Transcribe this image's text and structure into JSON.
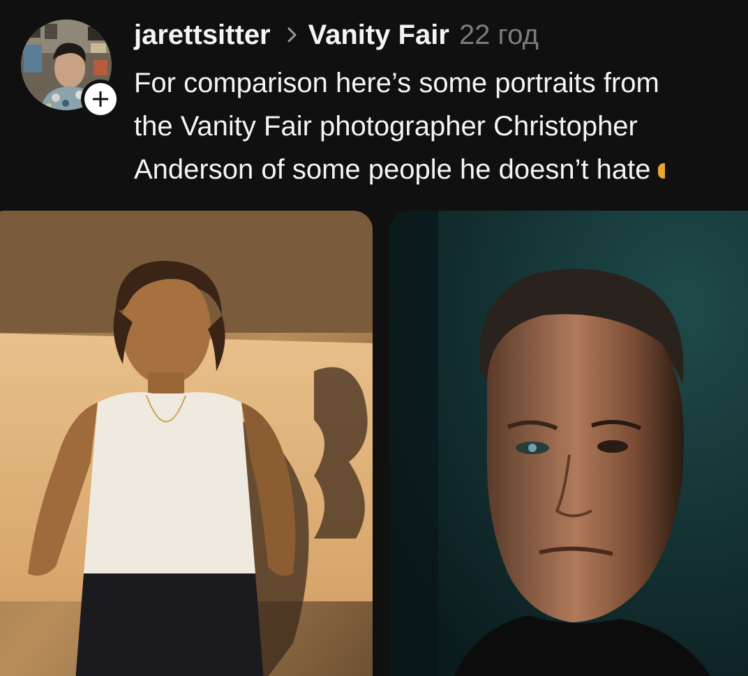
{
  "post": {
    "username": "jarettsitter",
    "community": "Vanity Fair",
    "time": "22 год",
    "text_lines": [
      "For comparison here’s some portraits from",
      "the Vanity Fair photographer Christopher",
      "Anderson of some people he doesn’t hate"
    ]
  },
  "icons": {
    "chevron": "chevron-right-icon",
    "follow": "plus-icon"
  },
  "colors": {
    "background": "#101010",
    "text": "#f5f5f5",
    "muted": "#7c7c7c"
  }
}
